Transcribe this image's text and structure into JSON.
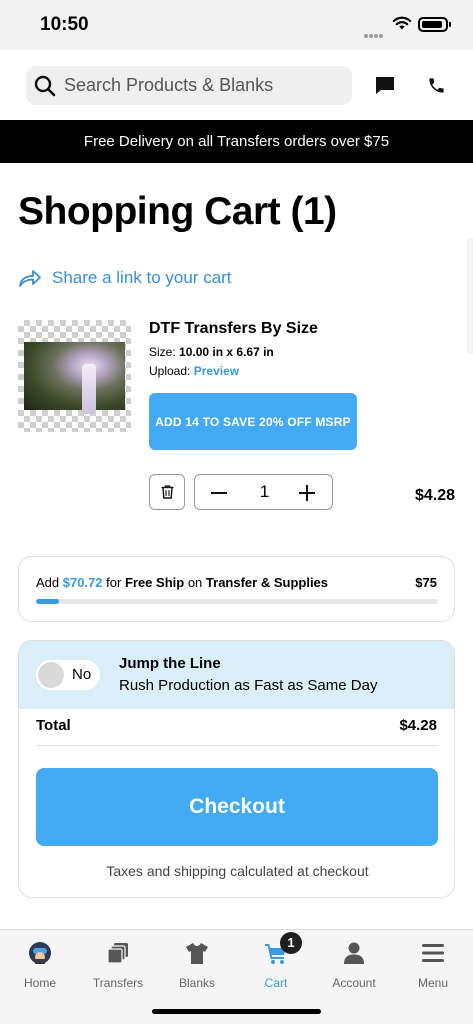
{
  "status_bar": {
    "time": "10:50"
  },
  "header": {
    "search_placeholder": "Search Products & Blanks",
    "icons": [
      "search-icon",
      "chat-icon",
      "phone-icon"
    ]
  },
  "promo_banner": "Free Delivery on all Transfers orders over $75",
  "page_title": "Shopping Cart (1)",
  "share_link": "Share a link to your cart",
  "cart_item": {
    "name": "DTF Transfers By Size",
    "size_label": "Size:",
    "size_value": "10.00 in x 6.67 in",
    "upload_label": "Upload:",
    "upload_link": "Preview",
    "promo_button": "ADD 14 TO SAVE 20% OFF MSRP",
    "quantity": "1",
    "price": "$4.28"
  },
  "free_ship": {
    "prefix": "Add",
    "amount": "$70.72",
    "for": "for",
    "free_ship": "Free Ship",
    "on": "on",
    "category": "Transfer & Supplies",
    "target": "$75",
    "progress_fraction": 0.057
  },
  "jump_line": {
    "toggle_label": "No",
    "title": "Jump the Line",
    "subtitle": "Rush Production as Fast as Same Day"
  },
  "summary": {
    "total_label": "Total",
    "total_value": "$4.28",
    "checkout_label": "Checkout",
    "tax_note": "Taxes and shipping calculated at checkout"
  },
  "bottom_nav": {
    "items": [
      {
        "label": "Home",
        "icon": "home-avatar-icon"
      },
      {
        "label": "Transfers",
        "icon": "transfers-icon"
      },
      {
        "label": "Blanks",
        "icon": "tshirt-icon"
      },
      {
        "label": "Cart",
        "icon": "cart-icon",
        "badge": "1"
      },
      {
        "label": "Account",
        "icon": "account-icon"
      },
      {
        "label": "Menu",
        "icon": "menu-icon"
      }
    ]
  },
  "colors": {
    "accent": "#45aaf5",
    "link": "#3a9ae0",
    "jump_bg": "#daeef8"
  }
}
